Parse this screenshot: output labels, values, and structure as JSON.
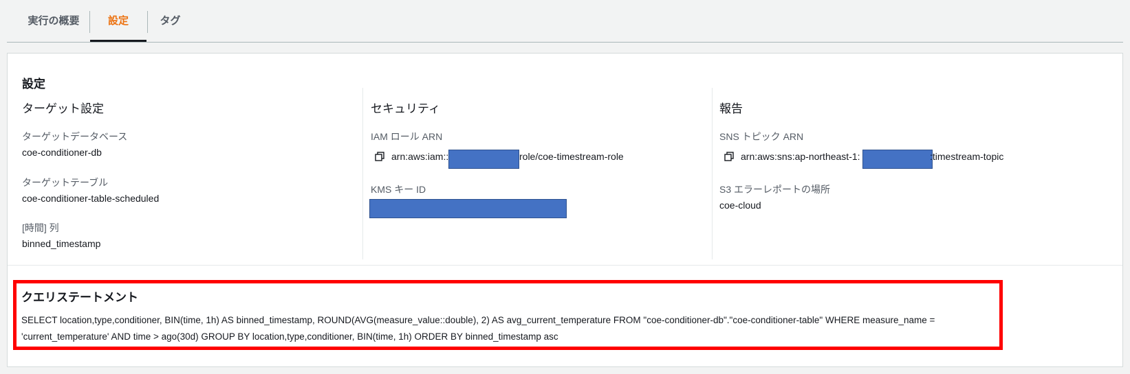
{
  "tabs": [
    {
      "label": "実行の概要"
    },
    {
      "label": "設定"
    },
    {
      "label": "タグ"
    }
  ],
  "settings": {
    "title": "設定",
    "target": {
      "heading": "ターゲット設定",
      "db_label": "ターゲットデータベース",
      "db_value": "coe-conditioner-db",
      "table_label": "ターゲットテーブル",
      "table_value": "coe-conditioner-table-scheduled",
      "time_label": "[時間] 列",
      "time_value": "binned_timestamp"
    },
    "security": {
      "heading": "セキュリティ",
      "iam_label": "IAM ロール ARN",
      "iam_prefix": "arn:aws:iam::",
      "iam_suffix": "role/coe-timestream-role",
      "kms_label": "KMS キー ID"
    },
    "report": {
      "heading": "報告",
      "sns_label": "SNS トピック ARN",
      "sns_prefix": "arn:aws:sns:ap-northeast-1:",
      "sns_suffix": ":timestream-topic",
      "s3_label": "S3 エラーレポートの場所",
      "s3_value": "coe-cloud"
    }
  },
  "query": {
    "title": "クエリステートメント",
    "text": "SELECT location,type,conditioner, BIN(time, 1h) AS binned_timestamp, ROUND(AVG(measure_value::double), 2) AS avg_current_temperature FROM \"coe-conditioner-db\".\"coe-conditioner-table\" WHERE measure_name = 'current_temperature' AND time > ago(30d) GROUP BY location,type,conditioner, BIN(time, 1h) ORDER BY binned_timestamp asc"
  },
  "colors": {
    "accent": "#ec7211",
    "redaction": "#4472c4",
    "highlight": "#ff0000"
  },
  "icons": [
    "copy-icon"
  ]
}
